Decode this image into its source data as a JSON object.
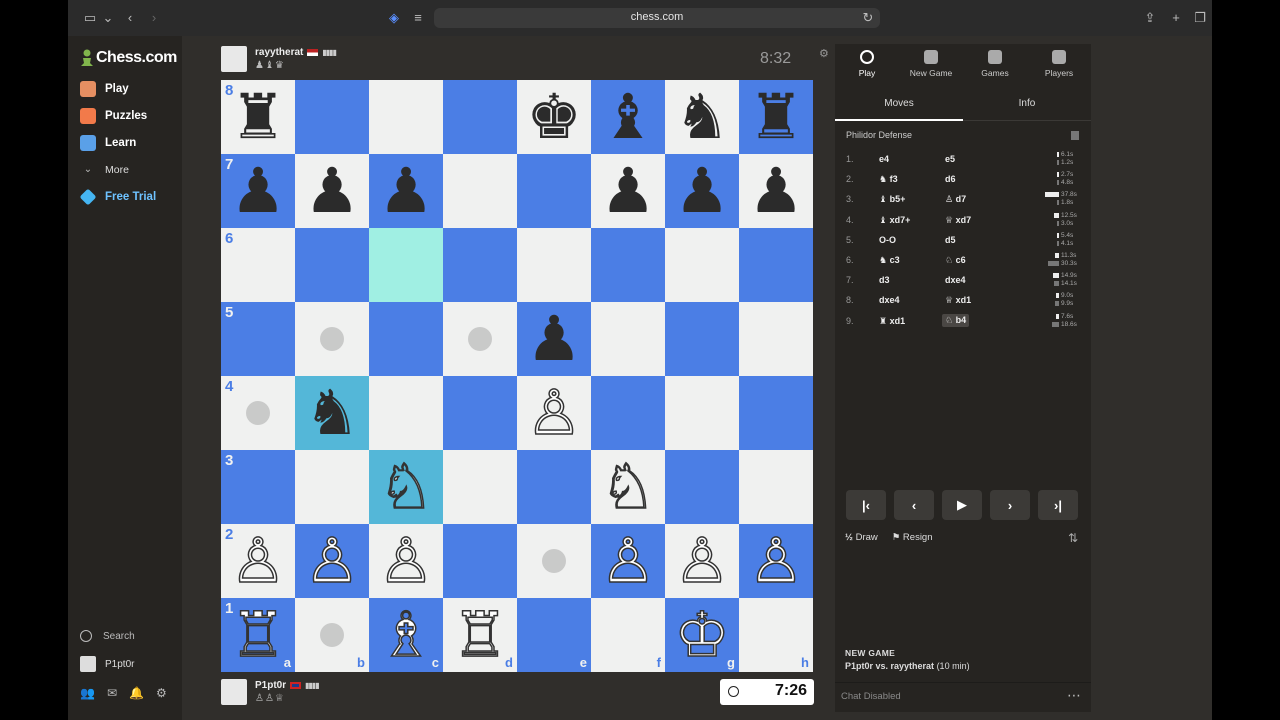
{
  "browser": {
    "url": "chess.com"
  },
  "sidebar": {
    "logo": "Chess.com",
    "items": [
      {
        "label": "Play",
        "color": "#e58f62"
      },
      {
        "label": "Puzzles",
        "color": "#f27a4a"
      },
      {
        "label": "Learn",
        "color": "#5aa0e8"
      },
      {
        "label": "More",
        "color": "#bbbbbb"
      },
      {
        "label": "Free Trial",
        "color": "#45b5f2"
      }
    ],
    "search_label": "Search",
    "username": "P1pt0r"
  },
  "top_player": {
    "name": "rayytherat",
    "captured": "♟♝♛",
    "clock": "8:32"
  },
  "bottom_player": {
    "name": "P1pt0r",
    "captured": "♙♙♕",
    "clock": "7:26"
  },
  "board": {
    "files": [
      "a",
      "b",
      "c",
      "d",
      "e",
      "f",
      "g",
      "h"
    ],
    "ranks": [
      "8",
      "7",
      "6",
      "5",
      "4",
      "3",
      "2",
      "1"
    ],
    "pieces": {
      "a8": "♜",
      "e8": "♚",
      "f8": "♝",
      "g8": "♞",
      "h8": "♜",
      "a7": "♟",
      "b7": "♟",
      "c7": "♟",
      "f7": "♟",
      "g7": "♟",
      "h7": "♟",
      "e5": "♟",
      "b4": "♞",
      "e4": "♙",
      "c3": "♘",
      "f3": "♘",
      "a2": "♙",
      "b2": "♙",
      "c2": "♙",
      "f2": "♙",
      "g2": "♙",
      "h2": "♙",
      "a1": "♖",
      "c1": "♗",
      "d1": "♖",
      "g1": "♔"
    },
    "black_squares": [
      "a8",
      "e8",
      "f8",
      "g8",
      "h8",
      "a7",
      "b7",
      "c7",
      "f7",
      "g7",
      "h7",
      "e5",
      "b4"
    ],
    "highlight": [
      "c6",
      "b4",
      "c3"
    ],
    "hints": [
      "b5",
      "d5",
      "a4",
      "e2",
      "b1"
    ]
  },
  "panel": {
    "tabs": [
      "Play",
      "New Game",
      "Games",
      "Players"
    ],
    "subtabs": [
      "Moves",
      "Info"
    ],
    "opening": "Philidor Defense",
    "moves": [
      {
        "n": "1.",
        "w": "e4",
        "b": "e5",
        "tw": "6.1s",
        "tb": "1.2s",
        "fw": 0.17,
        "fb": 0.05
      },
      {
        "n": "2.",
        "w": "♞ f3",
        "b": "d6",
        "tw": "2.7s",
        "tb": "4.8s",
        "fw": 0.08,
        "fb": 0.13
      },
      {
        "n": "3.",
        "w": "♝ b5+",
        "b": "♙ d7",
        "tw": "37.8s",
        "tb": "1.8s",
        "fw": 1.0,
        "fb": 0.05
      },
      {
        "n": "4.",
        "w": "♝ xd7+",
        "b": "♕ xd7",
        "tw": "12.5s",
        "tb": "3.0s",
        "fw": 0.34,
        "fb": 0.08
      },
      {
        "n": "5.",
        "w": "O-O",
        "b": "d5",
        "tw": "5.4s",
        "tb": "4.1s",
        "fw": 0.15,
        "fb": 0.11
      },
      {
        "n": "6.",
        "w": "♞ c3",
        "b": "♘ c6",
        "tw": "11.3s",
        "tb": "30.3s",
        "fw": 0.3,
        "fb": 0.8
      },
      {
        "n": "7.",
        "w": "d3",
        "b": "dxe4",
        "tw": "14.9s",
        "tb": "14.1s",
        "fw": 0.4,
        "fb": 0.38
      },
      {
        "n": "8.",
        "w": "dxe4",
        "b": "♕ xd1",
        "tw": "9.0s",
        "tb": "9.9s",
        "fw": 0.24,
        "fb": 0.27
      },
      {
        "n": "9.",
        "w": "♜ xd1",
        "b": "♘ b4",
        "tw": "7.6s",
        "tb": "18.6s",
        "fw": 0.21,
        "fb": 0.5
      }
    ],
    "draw_label": "Draw",
    "resign_label": "Resign",
    "new_game_heading": "NEW GAME",
    "new_game_players": "P1pt0r vs. rayytherat",
    "new_game_time": "(10 min)",
    "chat_status": "Chat Disabled"
  }
}
